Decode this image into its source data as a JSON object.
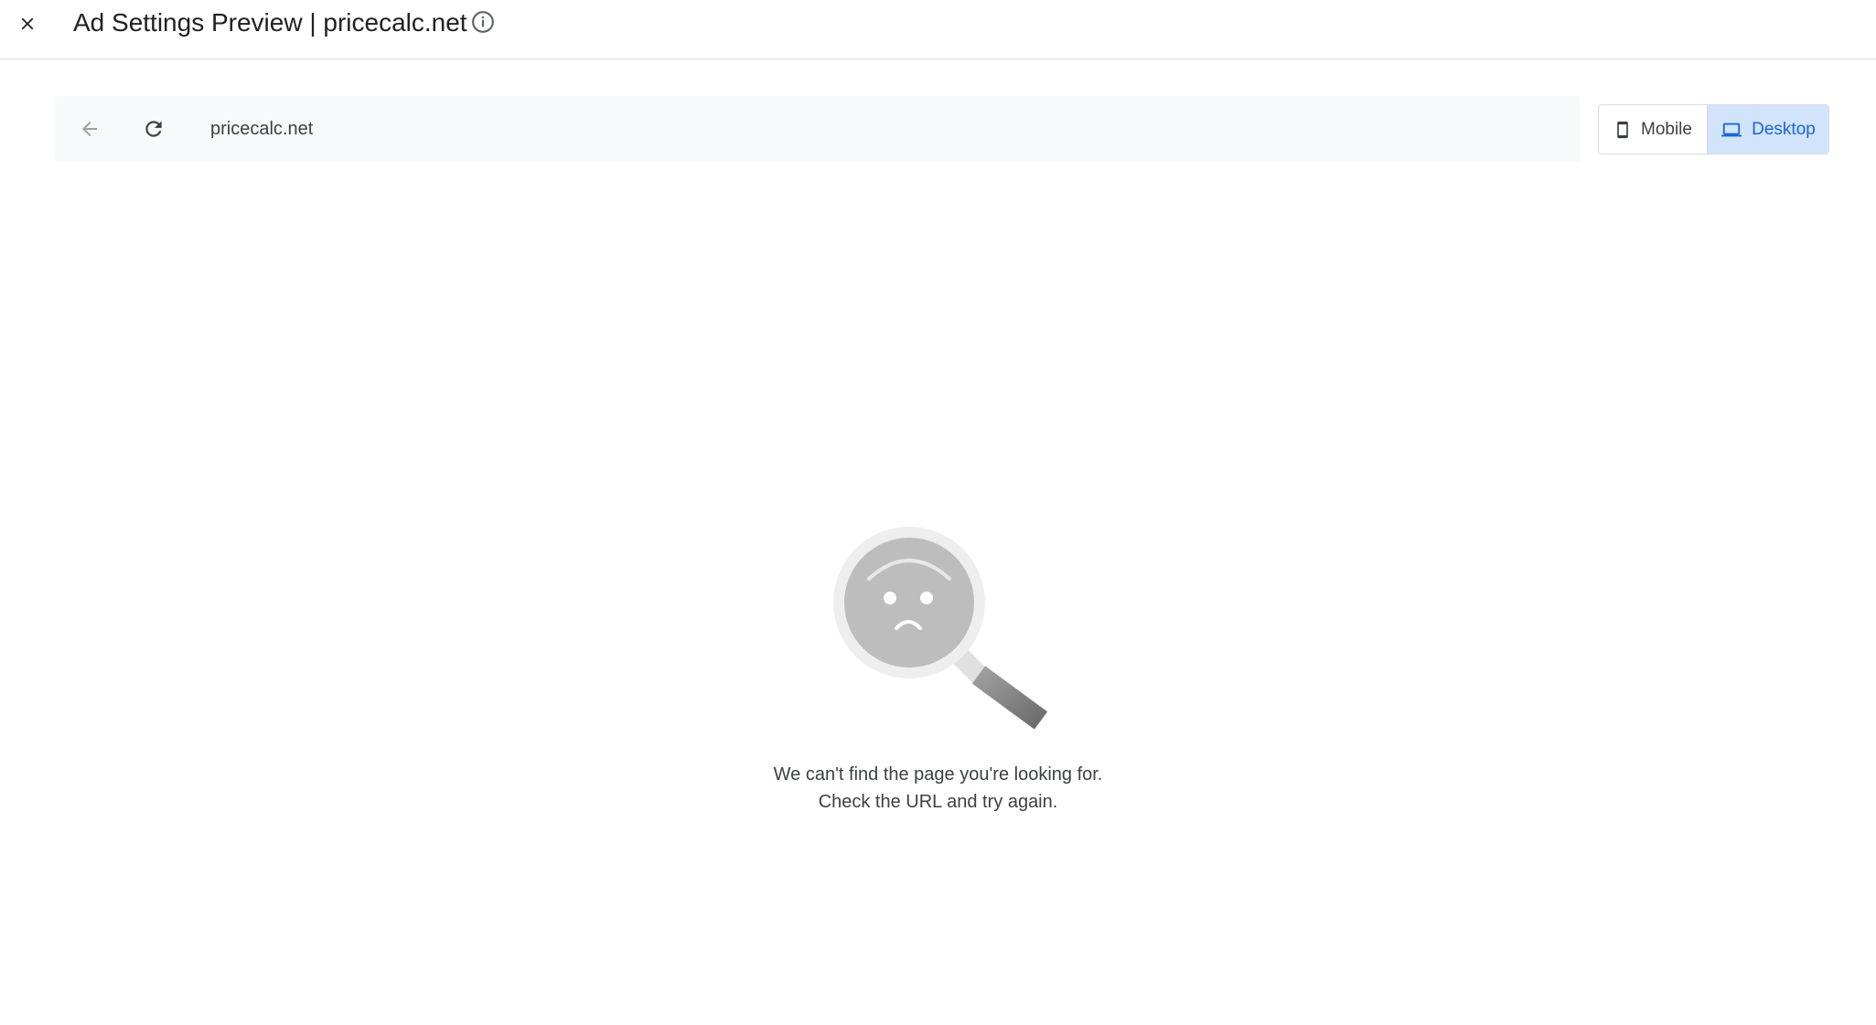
{
  "header": {
    "title": "Ad Settings Preview | pricecalc.net",
    "close_icon": "close-icon",
    "info_icon": "info-icon"
  },
  "browser": {
    "url": "pricecalc.net",
    "back_icon": "arrow-back-icon",
    "reload_icon": "refresh-icon"
  },
  "device_toggle": {
    "options": [
      {
        "label": "Mobile",
        "icon": "smartphone-icon",
        "selected": false
      },
      {
        "label": "Desktop",
        "icon": "laptop-icon",
        "selected": true
      }
    ],
    "selected_color": "#1967d2",
    "selected_bg": "#d2e3fc"
  },
  "error": {
    "illustration": "sad-magnifier-illustration",
    "line1": "We can't find the page you're looking for.",
    "line2": "Check the URL and try again."
  }
}
